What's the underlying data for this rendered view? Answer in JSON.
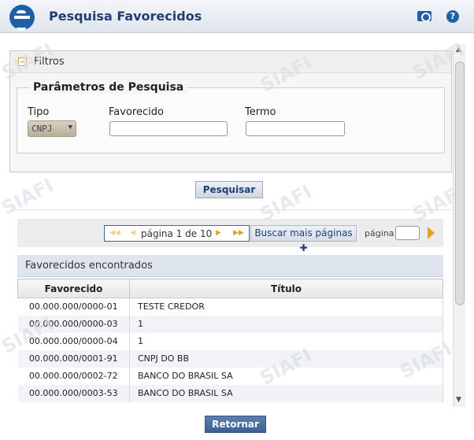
{
  "header": {
    "title": "Pesquisa Favorecidos"
  },
  "filters": {
    "title": "Filtros",
    "legend": "Parâmetros de Pesquisa",
    "tipo_label": "Tipo",
    "tipo_value": "CNPJ",
    "favorecido_label": "Favorecido",
    "termo_label": "Termo",
    "search_label": "Pesquisar"
  },
  "pager": {
    "text": "página 1 de 10",
    "more_label": "Buscar mais páginas",
    "page_label": "página"
  },
  "results": {
    "title": "Favorecidos encontrados",
    "columns": [
      "Favorecido",
      "Título"
    ],
    "rows": [
      {
        "favorecido": "00.000.000/0000-01",
        "titulo": "TESTE CREDOR"
      },
      {
        "favorecido": "00.000.000/0000-03",
        "titulo": "1"
      },
      {
        "favorecido": "00.000.000/0000-04",
        "titulo": "1"
      },
      {
        "favorecido": "00.000.000/0001-91",
        "titulo": "CNPJ DO BB"
      },
      {
        "favorecido": "00.000.000/0002-72",
        "titulo": "BANCO DO BRASIL SA"
      },
      {
        "favorecido": "00.000.000/0003-53",
        "titulo": "BANCO DO BRASIL SA"
      }
    ]
  },
  "footer": {
    "return_label": "Retornar"
  },
  "watermark_text": "SIAFI"
}
